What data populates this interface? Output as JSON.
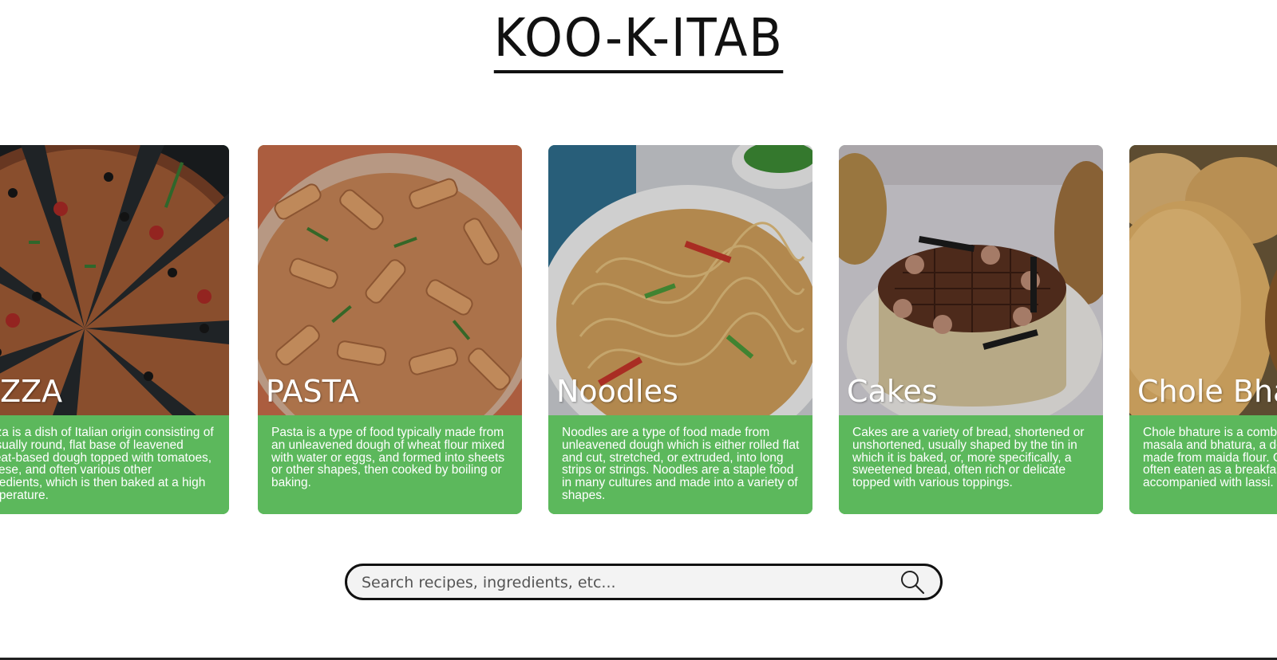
{
  "site": {
    "title": "KOO-K-ITAB"
  },
  "cards": [
    {
      "title": "PIZZA",
      "description": "Pizza is a dish of Italian origin consisting of a usually round, flat base of leavened wheat-based dough topped with tomatoes, cheese, and often various other ingredients, which is then baked at a high temperature.",
      "image_icon": "pizza-image"
    },
    {
      "title": "PASTA",
      "description": "Pasta is a type of food typically made from an unleavened dough of wheat flour mixed with water or eggs, and formed into sheets or other shapes, then cooked by boiling or baking.",
      "image_icon": "pasta-image"
    },
    {
      "title": "Noodles",
      "description": "Noodles are a type of food made from unleavened dough which is either rolled flat and cut, stretched, or extruded, into long strips or strings. Noodles are a staple food in many cultures and made into a variety of shapes.",
      "image_icon": "noodles-image"
    },
    {
      "title": "Cakes",
      "description": "Cakes are a variety of bread, shortened or unshortened, usually shaped by the tin in which it is baked, or, more specifically, a sweetened bread, often rich or delicate topped with various toppings.",
      "image_icon": "cake-image"
    },
    {
      "title": "Chole Bhature",
      "description": "Chole bhature is a combination of chana masala and bhatura, a deep-fried bread made from maida flour. Chole bhature is often eaten as a breakfast dish, sometimes accompanied with lassi.",
      "image_icon": "chole-bhature-image"
    }
  ],
  "search": {
    "placeholder": "Search recipes, ingredients, etc...",
    "value": "",
    "icon": "search-icon"
  },
  "colors": {
    "card_green": "#5cb85c",
    "title_black": "#111111",
    "search_bg": "#f3f3f3"
  }
}
